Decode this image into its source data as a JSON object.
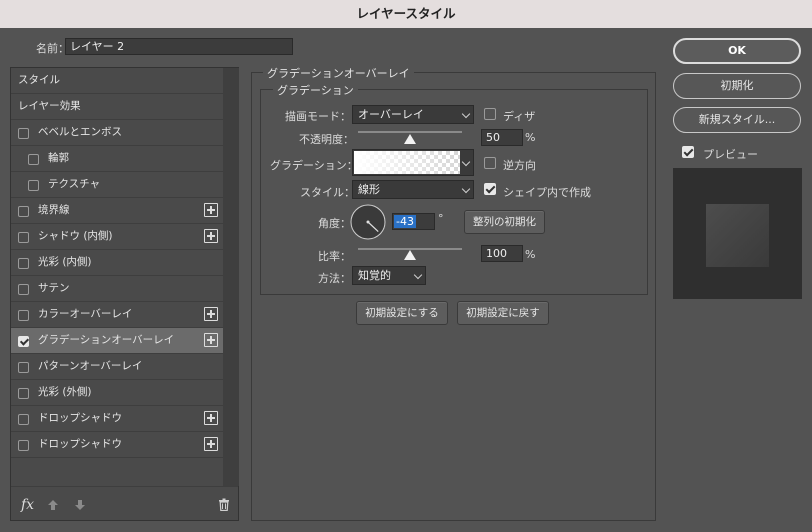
{
  "window": {
    "title": "レイヤースタイル"
  },
  "name_field": {
    "label": "名前：",
    "value": "レイヤー 2"
  },
  "sidebar": {
    "items": [
      {
        "label": "スタイル",
        "has_checkbox": false,
        "checked": false,
        "has_plus": false,
        "indent": false
      },
      {
        "label": "レイヤー効果",
        "has_checkbox": false,
        "checked": false,
        "has_plus": false,
        "indent": false
      },
      {
        "label": "ベベルとエンボス",
        "has_checkbox": true,
        "checked": false,
        "has_plus": false,
        "indent": false
      },
      {
        "label": "輪郭",
        "has_checkbox": true,
        "checked": false,
        "has_plus": false,
        "indent": true
      },
      {
        "label": "テクスチャ",
        "has_checkbox": true,
        "checked": false,
        "has_plus": false,
        "indent": true
      },
      {
        "label": "境界線",
        "has_checkbox": true,
        "checked": false,
        "has_plus": true,
        "indent": false
      },
      {
        "label": "シャドウ (内側)",
        "has_checkbox": true,
        "checked": false,
        "has_plus": true,
        "indent": false
      },
      {
        "label": "光彩 (内側)",
        "has_checkbox": true,
        "checked": false,
        "has_plus": false,
        "indent": false
      },
      {
        "label": "サテン",
        "has_checkbox": true,
        "checked": false,
        "has_plus": false,
        "indent": false
      },
      {
        "label": "カラーオーバーレイ",
        "has_checkbox": true,
        "checked": false,
        "has_plus": true,
        "indent": false
      },
      {
        "label": "グラデーションオーバーレイ",
        "has_checkbox": true,
        "checked": true,
        "has_plus": true,
        "indent": false,
        "selected": true
      },
      {
        "label": "パターンオーバーレイ",
        "has_checkbox": true,
        "checked": false,
        "has_plus": false,
        "indent": false
      },
      {
        "label": "光彩 (外側)",
        "has_checkbox": true,
        "checked": false,
        "has_plus": false,
        "indent": false
      },
      {
        "label": "ドロップシャドウ",
        "has_checkbox": true,
        "checked": false,
        "has_plus": true,
        "indent": false
      },
      {
        "label": "ドロップシャドウ",
        "has_checkbox": true,
        "checked": false,
        "has_plus": true,
        "indent": false
      }
    ],
    "bottom_icons": [
      "fx-icon",
      "move-up-icon",
      "move-down-icon",
      "trash-icon"
    ],
    "fx_label": "fx"
  },
  "panel": {
    "title": "グラデーションオーバーレイ",
    "subgroup_title": "グラデーション",
    "blend_mode": {
      "label": "描画モード：",
      "value": "オーバーレイ"
    },
    "dither": {
      "label": "ディザ",
      "checked": false
    },
    "opacity": {
      "label": "不透明度：",
      "value": "50",
      "unit": "%",
      "fraction": 0.5
    },
    "gradient": {
      "label": "グラデーション："
    },
    "reverse": {
      "label": "逆方向",
      "checked": false
    },
    "style": {
      "label": "スタイル：",
      "value": "線形"
    },
    "align_with_layer": {
      "label": "シェイプ内で作成",
      "checked": true
    },
    "angle": {
      "label": "角度：",
      "value": "-43",
      "unit": "°",
      "degrees": -43
    },
    "reset_alignment_label": "整列の初期化",
    "scale": {
      "label": "比率：",
      "value": "100",
      "unit": "%",
      "fraction": 0.5
    },
    "method": {
      "label": "方法：",
      "value": "知覚的"
    },
    "make_default_label": "初期設定にする",
    "reset_default_label": "初期設定に戻す"
  },
  "right": {
    "ok_label": "OK",
    "reset_label": "初期化",
    "new_style_label": "新規スタイル...",
    "preview": {
      "label": "プレビュー",
      "checked": true
    }
  },
  "colors": {
    "bg": "#535353",
    "highlight": "#2a71c6",
    "title_bar": "#e4dede"
  }
}
